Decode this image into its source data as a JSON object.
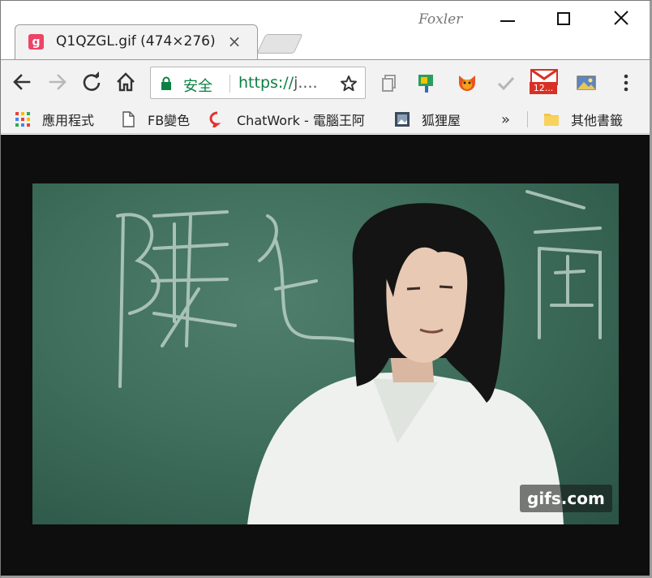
{
  "window": {
    "app_name": "Foxler",
    "controls": {
      "minimize": "minimize",
      "maximize": "maximize",
      "close": "close"
    }
  },
  "tab": {
    "favicon_letter": "g",
    "title": "Q1QZGL.gif (474×276)",
    "close": "×"
  },
  "toolbar": {
    "secure_label": "安全",
    "url_scheme": "https://",
    "url_rest": "j...."
  },
  "extensions": {
    "gmail_badge": "12..."
  },
  "bookmarks": {
    "apps": "應用程式",
    "fb": "FB變色",
    "chatwork": "ChatWork - 電腦王阿",
    "fox": "狐狸屋",
    "more": "»",
    "other": "其他書籤"
  },
  "content": {
    "watermark": "gifs.com"
  },
  "colors": {
    "secure_green": "#0b8043",
    "favicon_pink": "#ee4466",
    "chalkboard": "#3f6e5c",
    "page_background": "#0e0e0e"
  },
  "icons": {
    "back": "arrow-left-icon",
    "forward": "arrow-right-icon",
    "reload": "reload-icon",
    "home": "home-icon",
    "lock": "lock-icon",
    "bookmark_star": "star-icon",
    "menu": "vertical-dots-icon"
  }
}
